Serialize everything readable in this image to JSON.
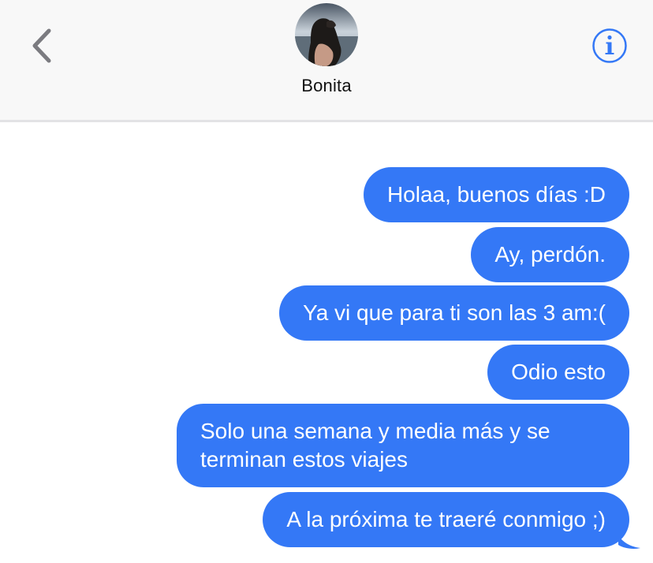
{
  "header": {
    "contact_name": "Bonita",
    "back_icon": "chevron-left-icon",
    "info_icon": "info-circle-icon",
    "accent_color": "#3478f6"
  },
  "messages": [
    {
      "direction": "outgoing",
      "text": "Holaa, buenos días :D"
    },
    {
      "direction": "outgoing",
      "text": "Ay, perdón."
    },
    {
      "direction": "outgoing",
      "text": "Ya vi que para ti son las 3 am:("
    },
    {
      "direction": "outgoing",
      "text": "Odio esto"
    },
    {
      "direction": "outgoing",
      "text": "Solo una semana y media más y se terminan estos viajes"
    },
    {
      "direction": "outgoing",
      "text": "A la próxima te traeré conmigo ;)"
    }
  ],
  "colors": {
    "bubble_outgoing": "#3478f6",
    "header_background": "#f8f8f8"
  }
}
